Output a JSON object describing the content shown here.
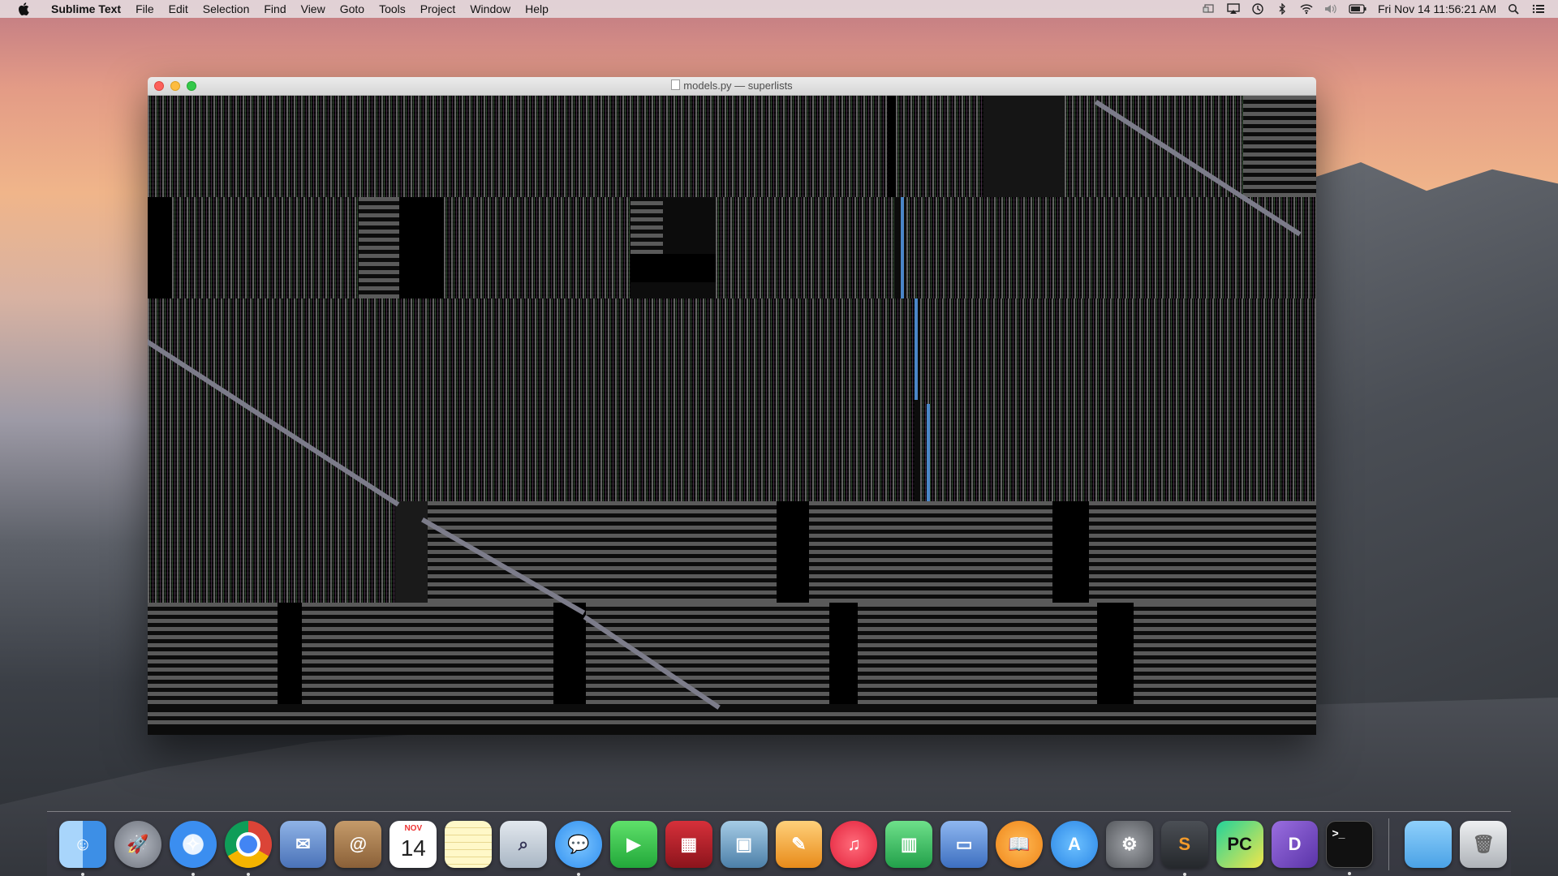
{
  "menubar": {
    "apple_icon": "apple-logo",
    "app_name": "Sublime Text",
    "items": [
      "File",
      "Edit",
      "Selection",
      "Find",
      "View",
      "Goto",
      "Tools",
      "Project",
      "Window",
      "Help"
    ],
    "status_icons": [
      "display-icon",
      "airplay-icon",
      "time-machine-icon",
      "bluetooth-icon",
      "wifi-icon",
      "volume-icon",
      "battery-icon"
    ],
    "clock": "Fri Nov 14  11:56:21 AM",
    "right_icons": [
      "spotlight-icon",
      "notification-center-icon"
    ]
  },
  "window": {
    "title": "models.py — superlists",
    "editor_state": "corrupted rendering of code text"
  },
  "dock": {
    "apps": [
      {
        "name": "Finder",
        "icon": "finder-icon",
        "color": "#4aa0f0",
        "running": true
      },
      {
        "name": "Launchpad",
        "icon": "launchpad-icon",
        "color": "#8a8f99",
        "running": false
      },
      {
        "name": "Safari",
        "icon": "safari-icon",
        "color": "#3b8ef0",
        "running": true
      },
      {
        "name": "Chrome",
        "icon": "chrome-icon",
        "color": "#e8e8e8",
        "running": true
      },
      {
        "name": "Mail",
        "icon": "mail-icon",
        "color": "#6b8fc9",
        "running": false
      },
      {
        "name": "Contacts",
        "icon": "contacts-icon",
        "color": "#a57b4f",
        "running": false
      },
      {
        "name": "Calendar",
        "icon": "calendar-icon",
        "color": "#ffffff",
        "running": false,
        "month": "NOV",
        "day": "14"
      },
      {
        "name": "Notes",
        "icon": "notes-icon",
        "color": "#f9e27a",
        "running": false
      },
      {
        "name": "Preview",
        "icon": "preview-icon",
        "color": "#c9d4df",
        "running": false
      },
      {
        "name": "Messages",
        "icon": "messages-icon",
        "color": "#49a6f5",
        "running": true
      },
      {
        "name": "FaceTime",
        "icon": "facetime-icon",
        "color": "#34c84a",
        "running": false
      },
      {
        "name": "Photo Booth",
        "icon": "photo-booth-icon",
        "color": "#b2222a",
        "running": false
      },
      {
        "name": "iPhoto",
        "icon": "iphoto-icon",
        "color": "#7aa8c8",
        "running": false
      },
      {
        "name": "Pages",
        "icon": "pages-icon",
        "color": "#f3a43b",
        "running": false
      },
      {
        "name": "iTunes",
        "icon": "itunes-icon",
        "color": "#f34456",
        "running": false
      },
      {
        "name": "Numbers",
        "icon": "numbers-icon",
        "color": "#2fb85a",
        "running": false
      },
      {
        "name": "Keynote",
        "icon": "keynote-icon",
        "color": "#5d8ed6",
        "running": false
      },
      {
        "name": "iBooks",
        "icon": "ibooks-icon",
        "color": "#f39a2a",
        "running": false
      },
      {
        "name": "App Store",
        "icon": "app-store-icon",
        "color": "#3a9bf0",
        "running": false
      },
      {
        "name": "System Preferences",
        "icon": "system-preferences-icon",
        "color": "#7d7f84",
        "running": false
      },
      {
        "name": "Sublime Text",
        "icon": "sublime-text-icon",
        "color": "#3a3d42",
        "running": true
      },
      {
        "name": "PyCharm",
        "icon": "pycharm-icon",
        "color": "#2fb87a",
        "running": false
      },
      {
        "name": "Dash",
        "icon": "dash-icon",
        "color": "#7a4fc2",
        "running": false
      },
      {
        "name": "Terminal",
        "icon": "terminal-icon",
        "color": "#1b1b1b",
        "running": true
      }
    ],
    "right": [
      {
        "name": "Downloads",
        "icon": "folder-icon",
        "color": "#5ab2ee"
      },
      {
        "name": "Trash",
        "icon": "trash-icon",
        "color": "#c8cbcf"
      }
    ]
  }
}
